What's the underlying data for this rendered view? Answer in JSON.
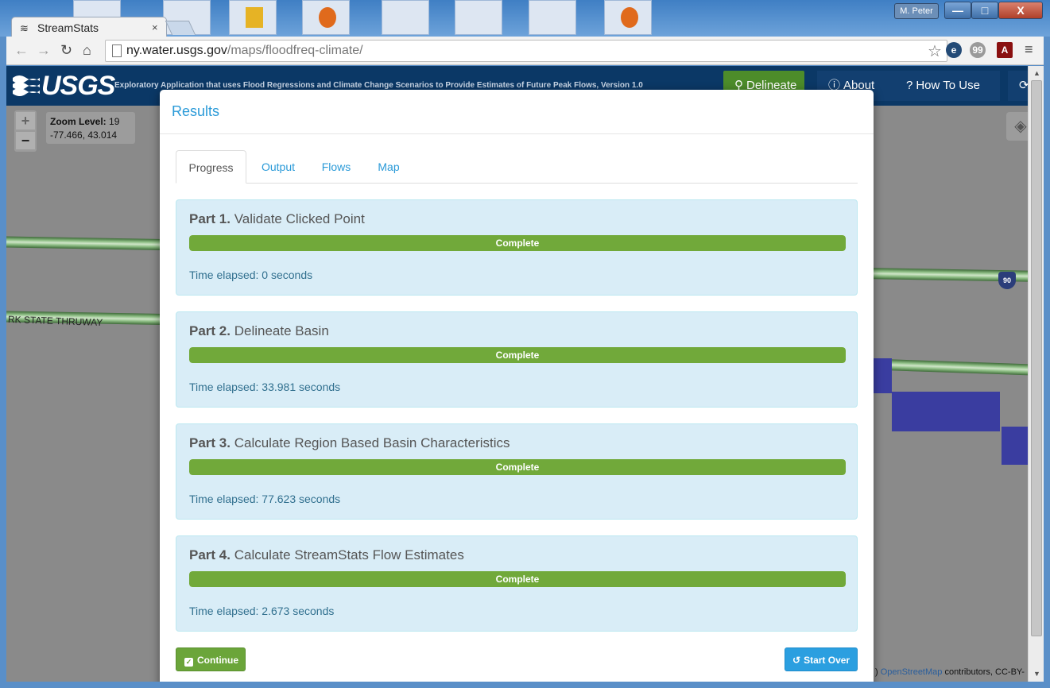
{
  "os": {
    "user_badge": "M. Peter",
    "window_buttons": {
      "minimize": "—",
      "maximize": "□",
      "close": "X"
    }
  },
  "browser": {
    "tab_title": "StreamStats",
    "tab_close": "×",
    "url_host": "ny.water.usgs.gov",
    "url_path": "/maps/floodfreq-climate/",
    "nav": {
      "back": "←",
      "forward": "→",
      "reload": "↻",
      "home": "⌂"
    },
    "star": "☆",
    "menu": "≡"
  },
  "app": {
    "logo_text": "USGS",
    "subtitle": "Exploratory Application that uses Flood Regressions and Climate Change Scenarios to Provide Estimates of Future Peak Flows, Version 1.0",
    "nav": {
      "delineate": "Delineate",
      "about": "About",
      "how_to_use": "How To Use"
    }
  },
  "map": {
    "zoom_in": "+",
    "zoom_out": "−",
    "zoom_label": "Zoom Level:",
    "zoom_level": "19",
    "coordinates": "-77.466, 43.014",
    "road_label": "RK STATE THRUWAY",
    "interstate": "90",
    "attribution_prefix": ")",
    "attribution_link": "OpenStreetMap",
    "attribution_suffix": " contributors, CC-BY-"
  },
  "modal": {
    "title": "Results",
    "tabs": [
      {
        "label": "Progress",
        "active": true
      },
      {
        "label": "Output",
        "active": false
      },
      {
        "label": "Flows",
        "active": false
      },
      {
        "label": "Map",
        "active": false
      }
    ],
    "parts": [
      {
        "number": "Part 1.",
        "name": "Validate Clicked Point",
        "status": "Complete",
        "progress_percent": 100,
        "elapsed": "Time elapsed: 0 seconds"
      },
      {
        "number": "Part 2.",
        "name": "Delineate Basin",
        "status": "Complete",
        "progress_percent": 100,
        "elapsed": "Time elapsed: 33.981 seconds"
      },
      {
        "number": "Part 3.",
        "name": "Calculate Region Based Basin Characteristics",
        "status": "Complete",
        "progress_percent": 100,
        "elapsed": "Time elapsed: 77.623 seconds"
      },
      {
        "number": "Part 4.",
        "name": "Calculate StreamStats Flow Estimates",
        "status": "Complete",
        "progress_percent": 100,
        "elapsed": "Time elapsed: 2.673 seconds"
      }
    ],
    "continue_label": "Continue",
    "start_over_label": "Start Over"
  },
  "colors": {
    "accent_blue": "#2a9ad8",
    "success_green": "#71a93a",
    "panel_bg": "#d9edf7",
    "usgs_navy": "#0b3866"
  }
}
